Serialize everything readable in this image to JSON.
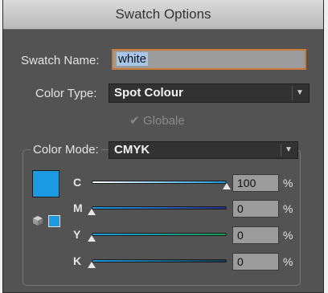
{
  "dialog": {
    "title": "Swatch Options"
  },
  "swatch_name": {
    "label": "Swatch Name:",
    "value": "white"
  },
  "color_type": {
    "label": "Color Type:",
    "value": "Spot Colour"
  },
  "global": {
    "label": "Globale",
    "checked": true,
    "enabled": false
  },
  "color_mode": {
    "label": "Color Mode:",
    "value": "CMYK",
    "sliders": [
      {
        "channel": "C",
        "value": "100",
        "unit": "%",
        "level": 1.0
      },
      {
        "channel": "M",
        "value": "0",
        "unit": "%",
        "level": 0.0
      },
      {
        "channel": "Y",
        "value": "0",
        "unit": "%",
        "level": 0.0
      },
      {
        "channel": "K",
        "value": "0",
        "unit": "%",
        "level": 0.0
      }
    ]
  },
  "colors": {
    "swatch_preview": "#1a9ae0",
    "cyan_track": "#1a9ae0",
    "magenta_track": "#2a2a8a",
    "yellow_track": "#1c9a50",
    "black_track": "#143a4a"
  },
  "icons": {
    "dropdown": "chevron-down-icon",
    "gamut": "cube-icon",
    "check": "checkmark-icon"
  }
}
